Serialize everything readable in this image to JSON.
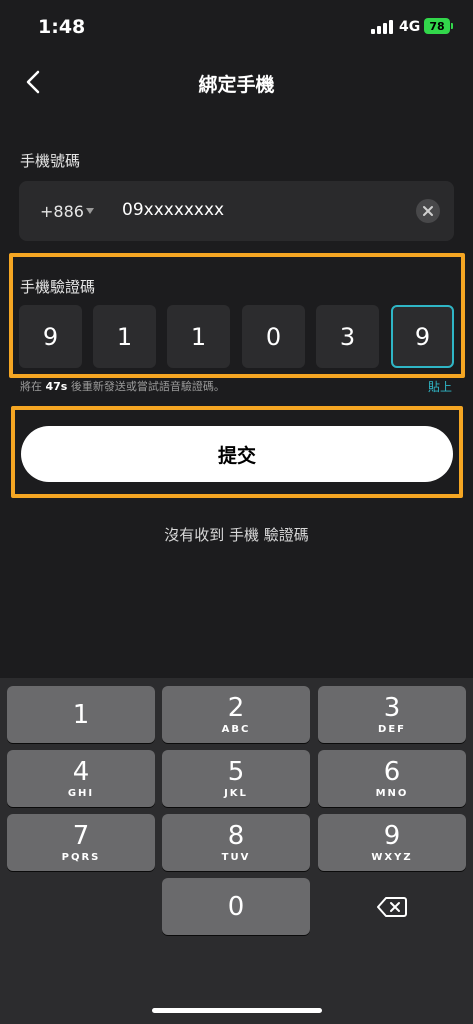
{
  "status_bar": {
    "time": "1:48",
    "network": "4G",
    "battery": "78"
  },
  "nav": {
    "title": "綁定手機"
  },
  "phone": {
    "label": "手機號碼",
    "country_code": "+886",
    "number": "09xxxxxxxx"
  },
  "code": {
    "label": "手機驗證碼",
    "digits": [
      "9",
      "1",
      "1",
      "0",
      "3",
      "9"
    ],
    "hint_prefix": "將在 ",
    "hint_seconds": "47s",
    "hint_suffix": " 後重新發送或嘗試語音驗證碼。",
    "paste_label": "貼上"
  },
  "submit_label": "提交",
  "no_code_label": "沒有收到 手機 驗證碼",
  "keypad": {
    "keys": [
      {
        "num": "1",
        "letters": ""
      },
      {
        "num": "2",
        "letters": "ABC"
      },
      {
        "num": "3",
        "letters": "DEF"
      },
      {
        "num": "4",
        "letters": "GHI"
      },
      {
        "num": "5",
        "letters": "JKL"
      },
      {
        "num": "6",
        "letters": "MNO"
      },
      {
        "num": "7",
        "letters": "PQRS"
      },
      {
        "num": "8",
        "letters": "TUV"
      },
      {
        "num": "9",
        "letters": "WXYZ"
      },
      {
        "num": "0",
        "letters": ""
      }
    ]
  },
  "colors": {
    "highlight": "#f5a623",
    "accent": "#2fb6c6",
    "background": "#1c1c1e"
  }
}
